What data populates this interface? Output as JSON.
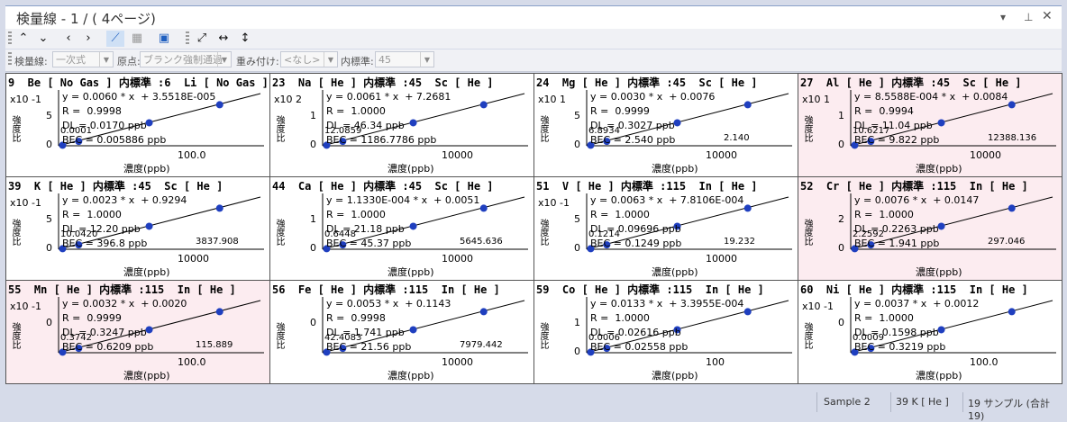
{
  "window": {
    "title": "検量線 - 1 / ( 4ページ)"
  },
  "toolbar2": {
    "curve_label": "検量線:",
    "curve_value": "一次式",
    "origin_label": "原点:",
    "origin_value": "ブランク強制通過",
    "weight_label": "重み付け:",
    "weight_value": "<なし>",
    "istd_label": "内標準:",
    "istd_value": "45"
  },
  "cells": [
    {
      "header": "9  Be [ No Gas ] 内標準 :6  Li [ No Gas ]",
      "eq": "y = 0.0060 * x  + 3.5518E-005",
      "r": "R =  0.9998",
      "dl": "DL = 0.0170 ppb",
      "bec": "BEC = 0.005886 ppb",
      "mult": "x10 -1",
      "xtick": "100.0",
      "yticks": [
        "5",
        "0"
      ],
      "extra": [
        "0.0001"
      ],
      "pink": false
    },
    {
      "header": "23  Na [ He ] 内標準 :45  Sc [ He ]",
      "eq": "y = 0.0061 * x  + 7.2681",
      "r": "R =  1.0000",
      "dl": "DL = 46.34 ppb",
      "bec": "BEC = 1186.7786 ppb",
      "mult": "x10 2",
      "xtick": "10000",
      "yticks": [
        "1",
        "0"
      ],
      "extra": [
        "12.0859"
      ],
      "pink": false
    },
    {
      "header": "24  Mg [ He ] 内標準 :45  Sc [ He ]",
      "eq": "y = 0.0030 * x  + 0.0076",
      "r": "R =  0.9999",
      "dl": "DL = 0.3027 ppb",
      "bec": "BEC = 2.540 ppb",
      "mult": "x10 1",
      "xtick": "10000",
      "yticks": [
        "5",
        "0"
      ],
      "extra": [
        "6.8934",
        "2.140"
      ],
      "pink": false
    },
    {
      "header": "27  Al [ He ] 内標準 :45  Sc [ He ]",
      "eq": "y = 8.5588E-004 * x  + 0.0084",
      "r": "R =  0.9994",
      "dl": "DL = 11.04 ppb",
      "bec": "BEC = 9.822 ppb",
      "mult": "x10 1",
      "xtick": "10000",
      "yticks": [
        "1",
        "0"
      ],
      "extra": [
        "10.6217",
        "12388.136"
      ],
      "pink": true
    },
    {
      "header": "39  K [ He ] 内標準 :45  Sc [ He ]",
      "eq": "y = 0.0023 * x  + 0.9294",
      "r": "R =  1.0000",
      "dl": "DL = 12.20 ppb",
      "bec": "BEC = 396.8 ppb",
      "mult": "x10 -1",
      "xtick": "10000",
      "yticks": [
        "5",
        "0"
      ],
      "extra": [
        "10.0420",
        "3837.908"
      ],
      "pink": false
    },
    {
      "header": "44  Ca [ He ] 内標準 :45  Sc [ He ]",
      "eq": "y = 1.1330E-004 * x  + 0.0051",
      "r": "R =  1.0000",
      "dl": "DL = 21.18 ppb",
      "bec": "BEC = 45.37 ppb",
      "mult": "",
      "xtick": "10000",
      "yticks": [
        "1",
        "0"
      ],
      "extra": [
        "0.6448",
        "5645.636"
      ],
      "pink": false
    },
    {
      "header": "51  V [ He ] 内標準 :115  In [ He ]",
      "eq": "y = 0.0063 * x  + 7.8106E-004",
      "r": "R =  1.0000",
      "dl": "DL = 0.09696 ppb",
      "bec": "BEC = 0.1249 ppb",
      "mult": "x10 -1",
      "xtick": "10000",
      "yticks": [
        "5",
        "0"
      ],
      "extra": [
        "0.1214",
        "19.232"
      ],
      "pink": false
    },
    {
      "header": "52  Cr [ He ] 内標準 :115  In [ He ]",
      "eq": "y = 0.0076 * x  + 0.0147",
      "r": "R =  1.0000",
      "dl": "DL = 0.2263 ppb",
      "bec": "BEC = 1.941 ppb",
      "mult": "",
      "xtick": "",
      "yticks": [
        "2",
        "0"
      ],
      "extra": [
        "2.2592",
        "297.046"
      ],
      "pink": true
    },
    {
      "header": "55  Mn [ He ] 内標準 :115  In [ He ]",
      "eq": "y = 0.0032 * x  + 0.0020",
      "r": "R =  0.9999",
      "dl": "DL = 0.3247 ppb",
      "bec": "BEC = 0.6209 ppb",
      "mult": "x10 -1",
      "xtick": "100.0",
      "yticks": [
        "0"
      ],
      "extra": [
        "0.3742",
        "115.889"
      ],
      "pink": true
    },
    {
      "header": "56  Fe [ He ] 内標準 :115  In [ He ]",
      "eq": "y = 0.0053 * x  + 0.1143",
      "r": "R =  0.9998",
      "dl": "DL = 1.741 ppb",
      "bec": "BEC = 21.56 ppb",
      "mult": "",
      "xtick": "10000",
      "yticks": [
        "0"
      ],
      "extra": [
        "42.4083",
        "7979.442"
      ],
      "pink": false
    },
    {
      "header": "59  Co [ He ] 内標準 :115  In [ He ]",
      "eq": "y = 0.0133 * x  + 3.3955E-004",
      "r": "R =  1.0000",
      "dl": "DL = 0.02616 ppb",
      "bec": "BEC = 0.02558 ppb",
      "mult": "",
      "xtick": "100",
      "yticks": [
        "1",
        "0"
      ],
      "extra": [
        "0.0006"
      ],
      "pink": false
    },
    {
      "header": "60  Ni [ He ] 内標準 :115  In [ He ]",
      "eq": "y = 0.0037 * x  + 0.0012",
      "r": "R =  1.0000",
      "dl": "DL = 0.1598 ppb",
      "bec": "BEC = 0.3219 ppb",
      "mult": "x10 -1",
      "xtick": "100.0",
      "yticks": [
        "0"
      ],
      "extra": [
        "0.0009"
      ],
      "pink": false
    }
  ],
  "axis": {
    "xlabel": "濃度(ppb)",
    "ylabel": "強度比"
  },
  "status": {
    "sample": "Sample 2",
    "element": "39  K  [ He ]",
    "count": "19 サンプル (合計 19)"
  }
}
